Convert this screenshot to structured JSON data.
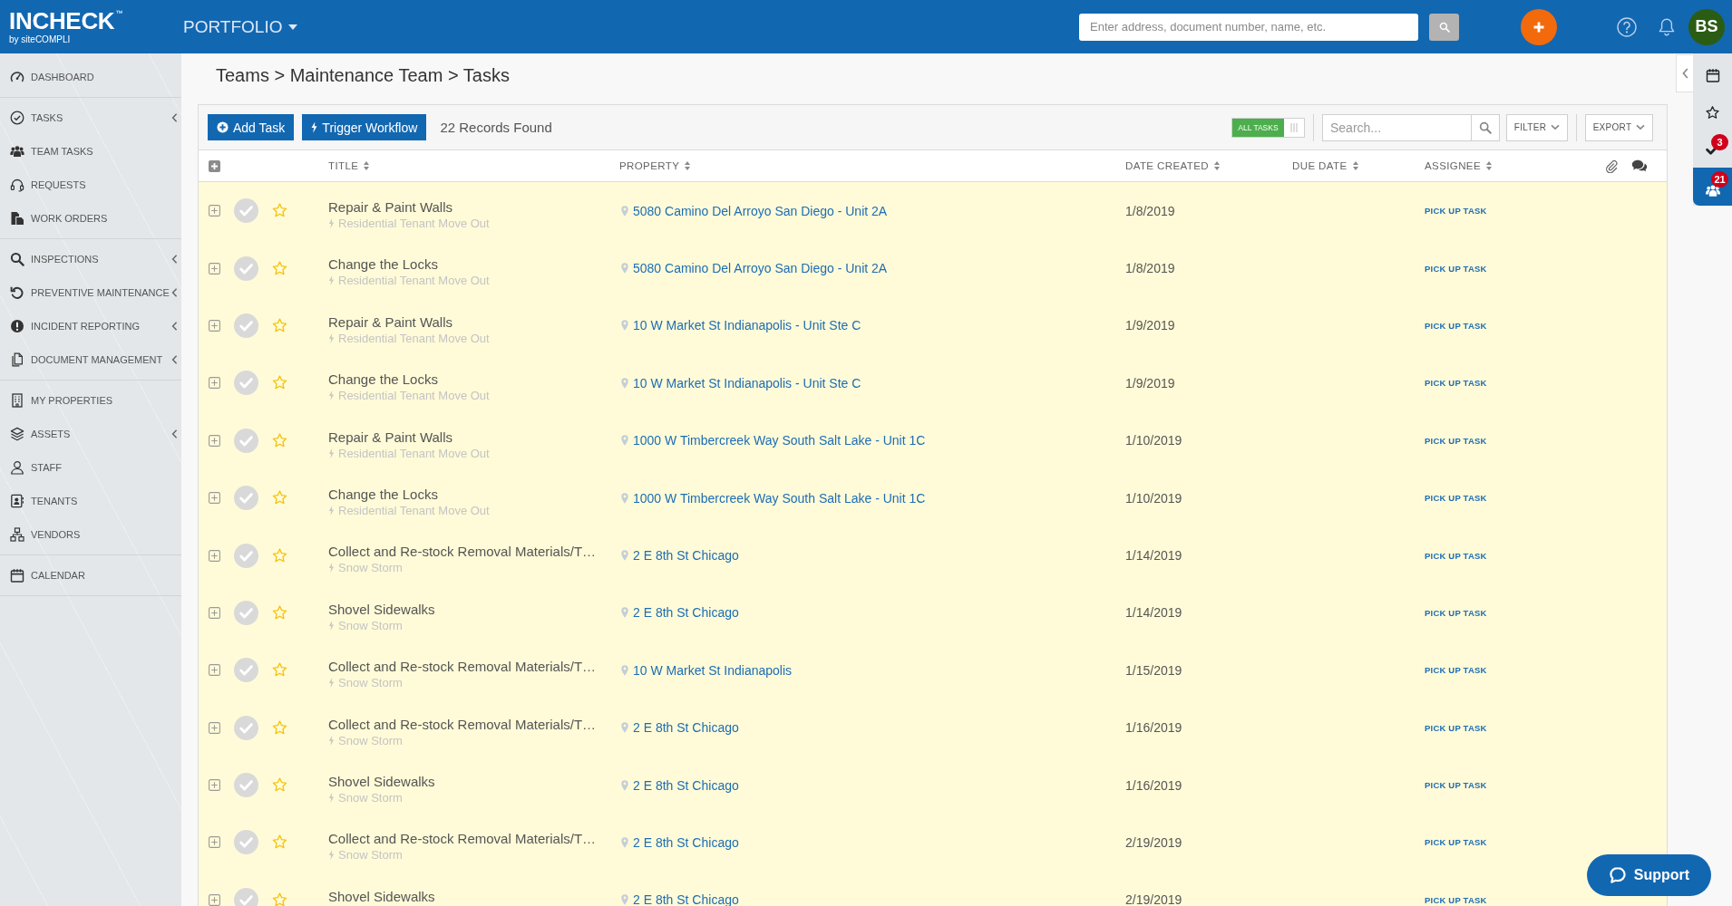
{
  "header": {
    "logo": "INCHECK$^{™}$",
    "tagline": "by siteCOMPLI",
    "portfolio": "PORTFOLIO",
    "search": {
      "placeholder": "Enter address, document number, name, etc."
    },
    "avatar": "BS"
  },
  "sidebar": {
    "groups": [
      {
        "items": [
          {
            "label": "DASHBOARD",
            "has_submenu": false
          }
        ]
      },
      {
        "items": [
          {
            "label": "TASKS",
            "has_submenu": true
          },
          {
            "label": "TEAM TASKS",
            "has_submenu": false
          },
          {
            "label": "REQUESTS",
            "has_submenu": false
          },
          {
            "label": "WORK ORDERS",
            "has_submenu": false
          }
        ]
      },
      {
        "items": [
          {
            "label": "INSPECTIONS",
            "has_submenu": true
          },
          {
            "label": "PREVENTIVE MAINTENANCE",
            "has_submenu": true
          },
          {
            "label": "INCIDENT REPORTING",
            "has_submenu": true
          },
          {
            "label": "DOCUMENT MANAGEMENT",
            "has_submenu": true
          }
        ]
      },
      {
        "items": [
          {
            "label": "MY PROPERTIES",
            "has_submenu": false
          },
          {
            "label": "ASSETS",
            "has_submenu": true
          },
          {
            "label": "STAFF",
            "has_submenu": false
          },
          {
            "label": "TENANTS",
            "has_submenu": false
          },
          {
            "label": "VENDORS",
            "has_submenu": false
          }
        ]
      },
      {
        "items": [
          {
            "label": "CALENDAR",
            "has_submenu": false
          }
        ]
      }
    ]
  },
  "breadcrumb": "Teams > Maintenance Team > Tasks",
  "toolbar": {
    "buttons": [
      {
        "kind": "add",
        "label": "Add Task"
      },
      {
        "kind": "workflow",
        "label": "Trigger Workflow"
      }
    ],
    "records": "22 Records Found",
    "toggle": {
      "label": "ALL TASKS",
      "on": true
    },
    "search": {
      "placeholder": "Search..."
    },
    "filter": "FILTER",
    "export": "EXPORT"
  },
  "table": {
    "columns": [
      {
        "label": "TITLE",
        "sortable": true
      },
      {
        "label": "PROPERTY",
        "sortable": true
      },
      {
        "label": "DATE CREATED",
        "sortable": true
      },
      {
        "label": "DUE DATE",
        "sortable": true
      },
      {
        "label": "ASSIGNEE",
        "sortable": true
      }
    ],
    "rows": [
      {
        "title": "Repair & Paint Walls",
        "workflow": "Residential Tenant Move Out",
        "property": "5080 Camino Del Arroyo San Diego - Unit 2A",
        "date_created": "1/8/2019",
        "assignee": "PICK UP TASK",
        "completed": false,
        "starred": false
      },
      {
        "title": "Change the Locks",
        "workflow": "Residential Tenant Move Out",
        "property": "5080 Camino Del Arroyo San Diego - Unit 2A",
        "date_created": "1/8/2019",
        "assignee": "PICK UP TASK",
        "completed": false,
        "starred": false
      },
      {
        "title": "Repair & Paint Walls",
        "workflow": "Residential Tenant Move Out",
        "property": "10 W Market St Indianapolis - Unit Ste C",
        "date_created": "1/9/2019",
        "assignee": "PICK UP TASK",
        "completed": false,
        "starred": false
      },
      {
        "title": "Change the Locks",
        "workflow": "Residential Tenant Move Out",
        "property": "10 W Market St Indianapolis - Unit Ste C",
        "date_created": "1/9/2019",
        "assignee": "PICK UP TASK",
        "completed": false,
        "starred": false
      },
      {
        "title": "Repair & Paint Walls",
        "workflow": "Residential Tenant Move Out",
        "property": "1000 W Timbercreek Way South Salt Lake - Unit 1C",
        "date_created": "1/10/2019",
        "assignee": "PICK UP TASK",
        "completed": false,
        "starred": false
      },
      {
        "title": "Change the Locks",
        "workflow": "Residential Tenant Move Out",
        "property": "1000 W Timbercreek Way South Salt Lake - Unit 1C",
        "date_created": "1/10/2019",
        "assignee": "PICK UP TASK",
        "completed": false,
        "starred": false
      },
      {
        "title": "Collect and Re-stock Removal Materials/T…",
        "workflow": "Snow Storm",
        "property": "2 E 8th St Chicago",
        "date_created": "1/14/2019",
        "assignee": "PICK UP TASK",
        "completed": false,
        "starred": false
      },
      {
        "title": "Shovel Sidewalks",
        "workflow": "Snow Storm",
        "property": "2 E 8th St Chicago",
        "date_created": "1/14/2019",
        "assignee": "PICK UP TASK",
        "completed": false,
        "starred": false
      },
      {
        "title": "Collect and Re-stock Removal Materials/T…",
        "workflow": "Snow Storm",
        "property": "10 W Market St Indianapolis",
        "date_created": "1/15/2019",
        "assignee": "PICK UP TASK",
        "completed": false,
        "starred": false
      },
      {
        "title": "Collect and Re-stock Removal Materials/T…",
        "workflow": "Snow Storm",
        "property": "2 E 8th St Chicago",
        "date_created": "1/16/2019",
        "assignee": "PICK UP TASK",
        "completed": false,
        "starred": false
      },
      {
        "title": "Shovel Sidewalks",
        "workflow": "Snow Storm",
        "property": "2 E 8th St Chicago",
        "date_created": "1/16/2019",
        "assignee": "PICK UP TASK",
        "completed": false,
        "starred": false
      },
      {
        "title": "Collect and Re-stock Removal Materials/T…",
        "workflow": "Snow Storm",
        "property": "2 E 8th St Chicago",
        "date_created": "2/19/2019",
        "assignee": "PICK UP TASK",
        "completed": false,
        "starred": false
      },
      {
        "title": "Shovel Sidewalks",
        "property": "2 E 8th St Chicago",
        "date_created": "2/19/2019",
        "assignee": "PICK UP TASK",
        "completed": false,
        "starred": false
      }
    ]
  },
  "right_rail": {
    "items": [
      {
        "selected": false
      },
      {
        "selected": false
      },
      {
        "badge": "3",
        "selected": false
      },
      {
        "badge": "21",
        "selected": true
      }
    ]
  },
  "support": {
    "label": "Support"
  }
}
